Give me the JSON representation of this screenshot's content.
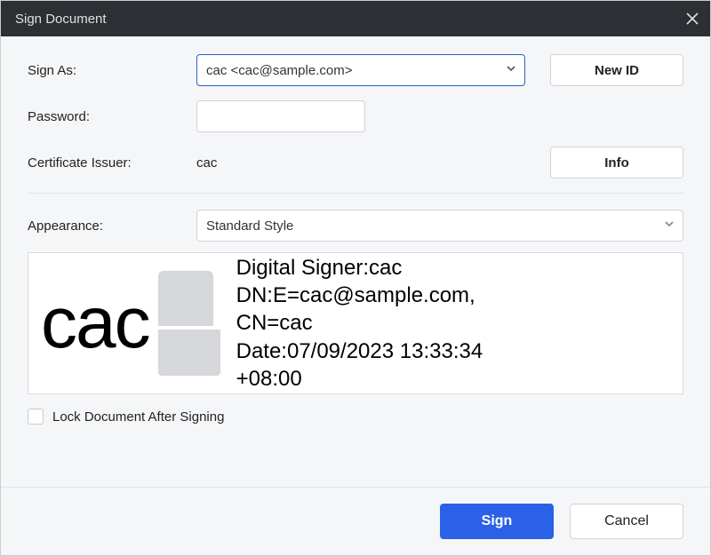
{
  "dialog": {
    "title": "Sign Document"
  },
  "labels": {
    "sign_as": "Sign As:",
    "password": "Password:",
    "cert_issuer": "Certificate Issuer:",
    "appearance": "Appearance:",
    "lock_after": "Lock Document After Signing"
  },
  "sign_as": {
    "selected": "cac <cac@sample.com>"
  },
  "buttons": {
    "new_id": "New ID",
    "info": "Info",
    "sign": "Sign",
    "cancel": "Cancel"
  },
  "password": {
    "value": ""
  },
  "cert_issuer": {
    "value": "cac"
  },
  "appearance": {
    "selected": "Standard Style"
  },
  "preview": {
    "name": "cac",
    "line1": "Digital Signer:cac",
    "line2": "DN:E=cac@sample.com,",
    "line3": "CN=cac",
    "line4": "Date:07/09/2023 13:33:34",
    "line5": "+08:00"
  },
  "lock_checked": false
}
